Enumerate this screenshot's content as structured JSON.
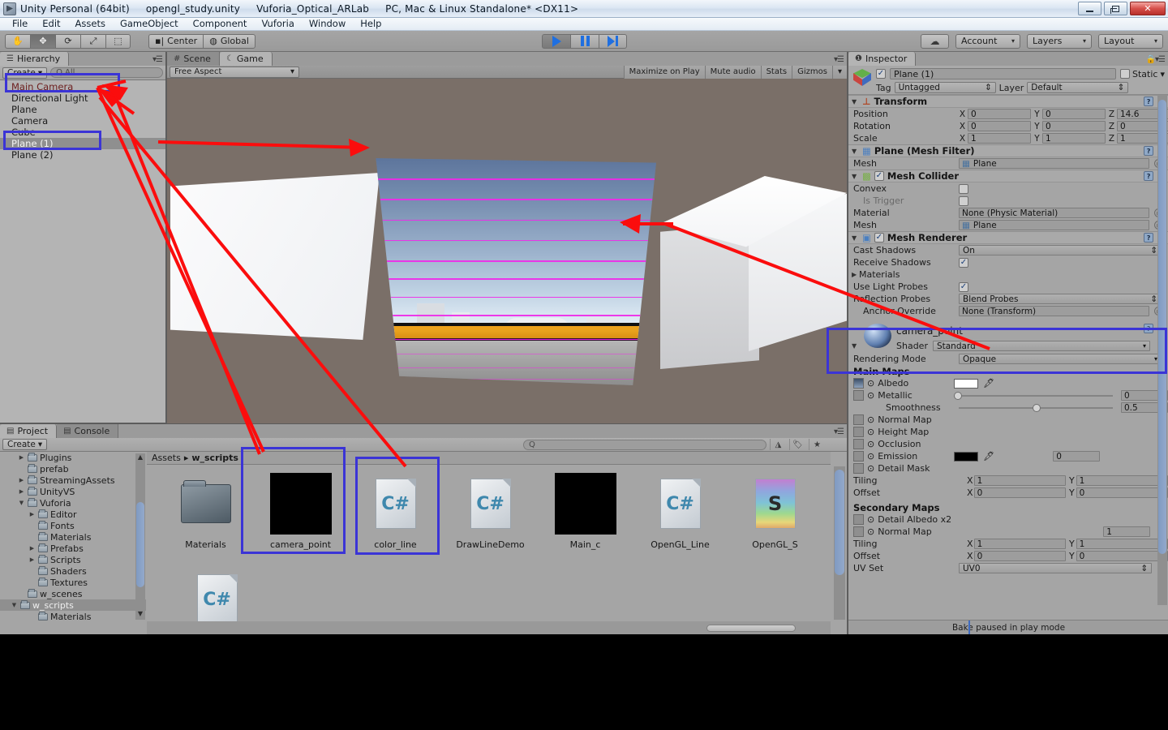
{
  "window": {
    "title_segments": [
      "Unity Personal (64bit)",
      "opengl_study.unity",
      "Vuforia_Optical_ARLab",
      "PC, Mac & Linux Standalone* <DX11>"
    ],
    "minimize_label": "_",
    "maximize_label": "□",
    "close_label": "✕"
  },
  "menu": [
    "File",
    "Edit",
    "Assets",
    "GameObject",
    "Component",
    "Vuforia",
    "Window",
    "Help"
  ],
  "toolbar": {
    "tools": [
      {
        "name": "hand-tool",
        "glyph": "✋"
      },
      {
        "name": "move-tool",
        "glyph": "✥"
      },
      {
        "name": "rotate-tool",
        "glyph": "⟳"
      },
      {
        "name": "scale-tool",
        "glyph": "⤢"
      },
      {
        "name": "rect-tool",
        "glyph": "⬚"
      }
    ],
    "pivot_label": "Center",
    "space_label": "Global",
    "play_label": "Play",
    "pause_label": "Pause",
    "step_label": "Step",
    "cloud_label": "Cloud",
    "account_label": "Account",
    "layers_label": "Layers",
    "layout_label": "Layout",
    "caret": "▾"
  },
  "hierarchy": {
    "tab_label": "Hierarchy",
    "create_label": "Create",
    "create_caret": "▾",
    "search_placeholder": "All",
    "search_icon": "Q",
    "items": [
      {
        "label": "Main Camera",
        "selected": false,
        "red": true
      },
      {
        "label": "Directional Light",
        "selected": false,
        "red": false
      },
      {
        "label": "Plane",
        "selected": false,
        "red": false
      },
      {
        "label": "Camera",
        "selected": false,
        "red": false
      },
      {
        "label": "Cube",
        "selected": false,
        "red": false
      },
      {
        "label": "Plane (1)",
        "selected": true,
        "red": false
      },
      {
        "label": "Plane (2)",
        "selected": false,
        "red": false
      }
    ]
  },
  "center_view": {
    "tabs": [
      {
        "label": "Scene",
        "icon": "#",
        "active": false
      },
      {
        "label": "Game",
        "icon": "☾",
        "active": true
      }
    ],
    "aspect_label": "Free Aspect",
    "aspect_caret": "▾",
    "buttons": [
      "Maximize on Play",
      "Mute audio",
      "Stats",
      "Gizmos"
    ],
    "gizmos_caret": "▾"
  },
  "inspector": {
    "tab_label": "Inspector",
    "tab_icon": "❶",
    "object_name": "Plane (1)",
    "static_label": "Static",
    "static_caret": "▾",
    "tag_label": "Tag",
    "tag_value": "Untagged",
    "layer_label": "Layer",
    "layer_value": "Default",
    "components": {
      "transform": {
        "title": "Transform",
        "rows": [
          {
            "label": "Position",
            "x": "0",
            "y": "0",
            "z": "14.6"
          },
          {
            "label": "Rotation",
            "x": "0",
            "y": "0",
            "z": "0"
          },
          {
            "label": "Scale",
            "x": "1",
            "y": "1",
            "z": "1"
          }
        ],
        "axis_labels": [
          "X",
          "Y",
          "Z"
        ]
      },
      "mesh_filter": {
        "title": "Plane (Mesh Filter)",
        "mesh_label": "Mesh",
        "mesh_value": "Plane"
      },
      "mesh_collider": {
        "title": "Mesh Collider",
        "convex_label": "Convex",
        "is_trigger_label": "Is Trigger",
        "material_label": "Material",
        "material_value": "None (Physic Material)",
        "mesh_label": "Mesh",
        "mesh_value": "Plane"
      },
      "mesh_renderer": {
        "title": "Mesh Renderer",
        "cast_shadows_label": "Cast Shadows",
        "cast_shadows_value": "On",
        "receive_shadows_label": "Receive Shadows",
        "materials_label": "Materials",
        "use_light_probes_label": "Use Light Probes",
        "reflection_probes_label": "Reflection Probes",
        "reflection_probes_value": "Blend Probes",
        "anchor_override_label": "Anchor Override",
        "anchor_override_value": "None (Transform)"
      },
      "material": {
        "name": "camera_point",
        "shader_label": "Shader",
        "shader_value": "Standard",
        "rendering_mode_label": "Rendering Mode",
        "rendering_mode_value": "Opaque",
        "main_maps_label": "Main Maps",
        "albedo_label": "Albedo",
        "albedo_color": "#ffffff",
        "metallic_label": "Metallic",
        "metallic_value": "0",
        "smoothness_label": "Smoothness",
        "smoothness_value": "0.5",
        "normal_map_label": "Normal Map",
        "height_map_label": "Height Map",
        "occlusion_label": "Occlusion",
        "emission_label": "Emission",
        "emission_color": "#000000",
        "emission_value": "0",
        "detail_mask_label": "Detail Mask",
        "tiling_label": "Tiling",
        "tiling_x": "1",
        "tiling_y": "1",
        "offset_label": "Offset",
        "offset_x": "0",
        "offset_y": "0",
        "secondary_maps_label": "Secondary Maps",
        "detail_albedo_label": "Detail Albedo x2",
        "sec_normal_map_label": "Normal Map",
        "sec_normal_value": "1",
        "sec_tiling_label": "Tiling",
        "sec_tiling_x": "1",
        "sec_tiling_y": "1",
        "sec_offset_label": "Offset",
        "sec_offset_x": "0",
        "sec_offset_y": "0",
        "uv_set_label": "UV Set",
        "uv_set_value": "UV0"
      }
    },
    "status_message": "Bake paused in play mode"
  },
  "project": {
    "tabs": [
      {
        "label": "Project",
        "icon": "▤",
        "active": true
      },
      {
        "label": "Console",
        "icon": "▤",
        "active": false
      }
    ],
    "create_label": "Create",
    "create_caret": "▾",
    "search_placeholder": "",
    "search_icon": "Q",
    "filter_icons": [
      "asset-filter-icon",
      "label-filter-icon",
      "favorite-filter-icon"
    ],
    "tree": [
      {
        "label": "Plugins",
        "indent": 1,
        "arrow": "▶",
        "selected": false
      },
      {
        "label": "prefab",
        "indent": 1,
        "arrow": "",
        "selected": false
      },
      {
        "label": "StreamingAssets",
        "indent": 1,
        "arrow": "▶",
        "selected": false
      },
      {
        "label": "UnityVS",
        "indent": 1,
        "arrow": "▶",
        "selected": false
      },
      {
        "label": "Vuforia",
        "indent": 1,
        "arrow": "▼",
        "selected": false
      },
      {
        "label": "Editor",
        "indent": 2,
        "arrow": "▶",
        "selected": false
      },
      {
        "label": "Fonts",
        "indent": 2,
        "arrow": "",
        "selected": false
      },
      {
        "label": "Materials",
        "indent": 2,
        "arrow": "",
        "selected": false
      },
      {
        "label": "Prefabs",
        "indent": 2,
        "arrow": "▶",
        "selected": false
      },
      {
        "label": "Scripts",
        "indent": 2,
        "arrow": "▶",
        "selected": false
      },
      {
        "label": "Shaders",
        "indent": 2,
        "arrow": "",
        "selected": false
      },
      {
        "label": "Textures",
        "indent": 2,
        "arrow": "",
        "selected": false
      },
      {
        "label": "w_scenes",
        "indent": 1,
        "arrow": "",
        "selected": false
      },
      {
        "label": "w_scripts",
        "indent": 1,
        "arrow": "▼",
        "selected": true
      },
      {
        "label": "Materials",
        "indent": 2,
        "arrow": "",
        "selected": false
      }
    ],
    "breadcrumb": [
      "Assets",
      "w_scripts"
    ],
    "breadcrumb_sep": "▸",
    "assets": [
      {
        "label": "Materials",
        "kind": "folder"
      },
      {
        "label": "camera_point",
        "kind": "black"
      },
      {
        "label": "color_line",
        "kind": "csharp",
        "glyph": "C#"
      },
      {
        "label": "DrawLineDemo",
        "kind": "csharp",
        "glyph": "C#"
      },
      {
        "label": "Main_c",
        "kind": "black"
      },
      {
        "label": "OpenGL_Line",
        "kind": "csharp",
        "glyph": "C#"
      },
      {
        "label": "OpenGL_S",
        "kind": "shader",
        "glyph": "S"
      }
    ]
  },
  "annotations": {
    "box_color": "#3b34d6",
    "arrow_color": "#fb0d0d",
    "boxes": [
      {
        "name": "hierarchy-main-camera-highlight"
      },
      {
        "name": "hierarchy-plane1-highlight"
      },
      {
        "name": "inspector-material-highlight"
      },
      {
        "name": "project-camera-point-highlight"
      },
      {
        "name": "project-color-line-highlight"
      }
    ]
  }
}
